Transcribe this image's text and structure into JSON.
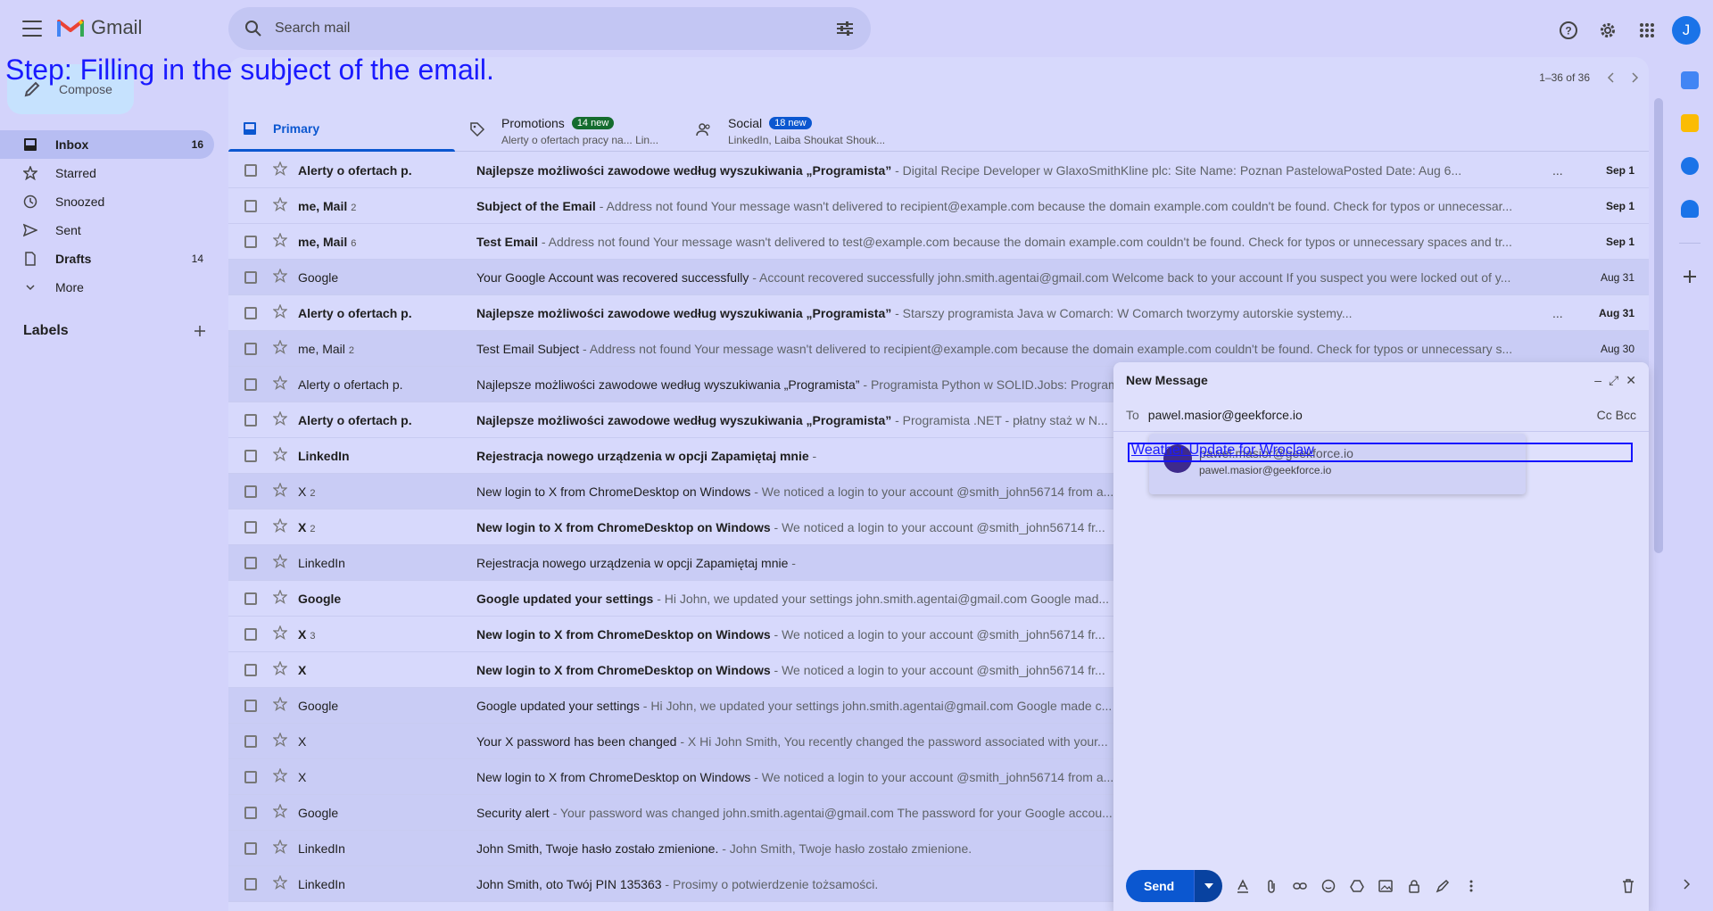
{
  "step_overlay": "Step: Filling in the subject of the email.",
  "header": {
    "app_name": "Gmail",
    "search_placeholder": "Search mail",
    "avatar_letter": "J"
  },
  "nav": {
    "compose_label": "Compose",
    "items": [
      {
        "label": "Inbox",
        "count": "16"
      },
      {
        "label": "Starred",
        "count": ""
      },
      {
        "label": "Snoozed",
        "count": ""
      },
      {
        "label": "Sent",
        "count": ""
      },
      {
        "label": "Drafts",
        "count": "14"
      },
      {
        "label": "More",
        "count": ""
      }
    ],
    "labels_title": "Labels"
  },
  "toolbar": {
    "page_range": "1–36 of 36"
  },
  "tabs": [
    {
      "label": "Primary",
      "badge": "",
      "sub": ""
    },
    {
      "label": "Promotions",
      "badge": "14 new",
      "badge_color": "#146c2e",
      "sub": "Alerty o ofertach pracy na... Lin..."
    },
    {
      "label": "Social",
      "badge": "18 new",
      "badge_color": "#0b57d0",
      "sub": "LinkedIn, Laiba Shoukat Shouk..."
    }
  ],
  "emails": [
    {
      "sender": "Alerty o ofertach p.",
      "count": "",
      "subject": "Najlepsze możliwości zawodowe według wyszukiwania „Programista”",
      "snippet": " - Digital Recipe Developer w GlaxoSmithKline plc: Site Name: Poznan PastelowaPosted Date: Aug 6...",
      "date": "Sep 1",
      "unread": true,
      "dots": "..."
    },
    {
      "sender": "me, Mail",
      "count": "2",
      "subject": "Subject of the Email",
      "snippet": " - Address not found Your message wasn't delivered to recipient@example.com because the domain example.com couldn't be found. Check for typos or unnecessar...",
      "date": "Sep 1",
      "unread": true,
      "dots": ""
    },
    {
      "sender": "me, Mail",
      "count": "6",
      "subject": "Test Email",
      "snippet": " - Address not found Your message wasn't delivered to test@example.com because the domain example.com couldn't be found. Check for typos or unnecessary spaces and tr...",
      "date": "Sep 1",
      "unread": true,
      "dots": ""
    },
    {
      "sender": "Google",
      "count": "",
      "subject": "Your Google Account was recovered successfully",
      "snippet": " - Account recovered successfully john.smith.agentai@gmail.com Welcome back to your account If you suspect you were locked out of y...",
      "date": "Aug 31",
      "unread": false,
      "dots": ""
    },
    {
      "sender": "Alerty o ofertach p.",
      "count": "",
      "subject": "Najlepsze możliwości zawodowe według wyszukiwania „Programista”",
      "snippet": " - Starszy programista Java w Comarch: W Comarch tworzymy autorskie systemy...",
      "date": "Aug 31",
      "unread": true,
      "dots": "..."
    },
    {
      "sender": "me, Mail",
      "count": "2",
      "subject": "Test Email Subject",
      "snippet": " - Address not found Your message wasn't delivered to recipient@example.com because the domain example.com couldn't be found. Check for typos or unnecessary s...",
      "date": "Aug 30",
      "unread": false,
      "dots": ""
    },
    {
      "sender": "Alerty o ofertach p.",
      "count": "",
      "subject": "Najlepsze możliwości zawodowe według wyszukiwania „Programista”",
      "snippet": " - Programista Python w SOLID.Jobs: Programista Python...",
      "date": "",
      "unread": false,
      "dots": ""
    },
    {
      "sender": "Alerty o ofertach p.",
      "count": "",
      "subject": "Najlepsze możliwości zawodowe według wyszukiwania „Programista”",
      "snippet": " - Programista .NET - płatny staż w N...",
      "date": "",
      "unread": true,
      "dots": ""
    },
    {
      "sender": "LinkedIn",
      "count": "",
      "subject": "Rejestracja nowego urządzenia w opcji Zapamiętaj mnie",
      "snippet": " -",
      "date": "",
      "unread": true,
      "dots": ""
    },
    {
      "sender": "X",
      "count": "2",
      "subject": "New login to X from ChromeDesktop on Windows",
      "snippet": " - We noticed a login to your account @smith_john56714 from a...",
      "date": "",
      "unread": false,
      "dots": ""
    },
    {
      "sender": "X",
      "count": "2",
      "subject": "New login to X from ChromeDesktop on Windows",
      "snippet": " - We noticed a login to your account @smith_john56714 fr...",
      "date": "",
      "unread": true,
      "dots": ""
    },
    {
      "sender": "LinkedIn",
      "count": "",
      "subject": "Rejestracja nowego urządzenia w opcji Zapamiętaj mnie",
      "snippet": " -",
      "date": "",
      "unread": false,
      "dots": ""
    },
    {
      "sender": "Google",
      "count": "",
      "subject": "Google updated your settings",
      "snippet": " - Hi John, we updated your settings john.smith.agentai@gmail.com Google mad...",
      "date": "",
      "unread": true,
      "dots": ""
    },
    {
      "sender": "X",
      "count": "3",
      "subject": "New login to X from ChromeDesktop on Windows",
      "snippet": " - We noticed a login to your account @smith_john56714 fr...",
      "date": "",
      "unread": true,
      "dots": ""
    },
    {
      "sender": "X",
      "count": "",
      "subject": "New login to X from ChromeDesktop on Windows",
      "snippet": " - We noticed a login to your account @smith_john56714 fr...",
      "date": "",
      "unread": true,
      "dots": ""
    },
    {
      "sender": "Google",
      "count": "",
      "subject": "Google updated your settings",
      "snippet": " - Hi John, we updated your settings john.smith.agentai@gmail.com Google made c...",
      "date": "",
      "unread": false,
      "dots": ""
    },
    {
      "sender": "X",
      "count": "",
      "subject": "Your X password has been changed",
      "snippet": " - X Hi John Smith, You recently changed the password associated with your...",
      "date": "",
      "unread": false,
      "dots": ""
    },
    {
      "sender": "X",
      "count": "",
      "subject": "New login to X from ChromeDesktop on Windows",
      "snippet": " - We noticed a login to your account @smith_john56714 from a...",
      "date": "",
      "unread": false,
      "dots": ""
    },
    {
      "sender": "Google",
      "count": "",
      "subject": "Security alert",
      "snippet": " - Your password was changed john.smith.agentai@gmail.com The password for your Google accou...",
      "date": "",
      "unread": false,
      "dots": ""
    },
    {
      "sender": "LinkedIn",
      "count": "",
      "subject": "John Smith, Twoje hasło zostało zmienione.",
      "snippet": " - John Smith, Twoje hasło zostało zmienione.",
      "date": "",
      "unread": false,
      "dots": ""
    },
    {
      "sender": "LinkedIn",
      "count": "",
      "subject": "John Smith, oto Twój PIN 135363",
      "snippet": " - Prosimy o potwierdzenie tożsamości.",
      "date": "",
      "unread": false,
      "dots": ""
    }
  ],
  "compose": {
    "title": "New Message",
    "to_label": "To",
    "to_value": "pawel.masior@geekforce.io",
    "cc_bcc": "Cc Bcc",
    "subject_value": "Weather Update for Wroclaw",
    "suggestion_name": "pawel.masior@geekforce.io",
    "suggestion_email": "pawel.masior@geekforce.io",
    "send_label": "Send"
  }
}
